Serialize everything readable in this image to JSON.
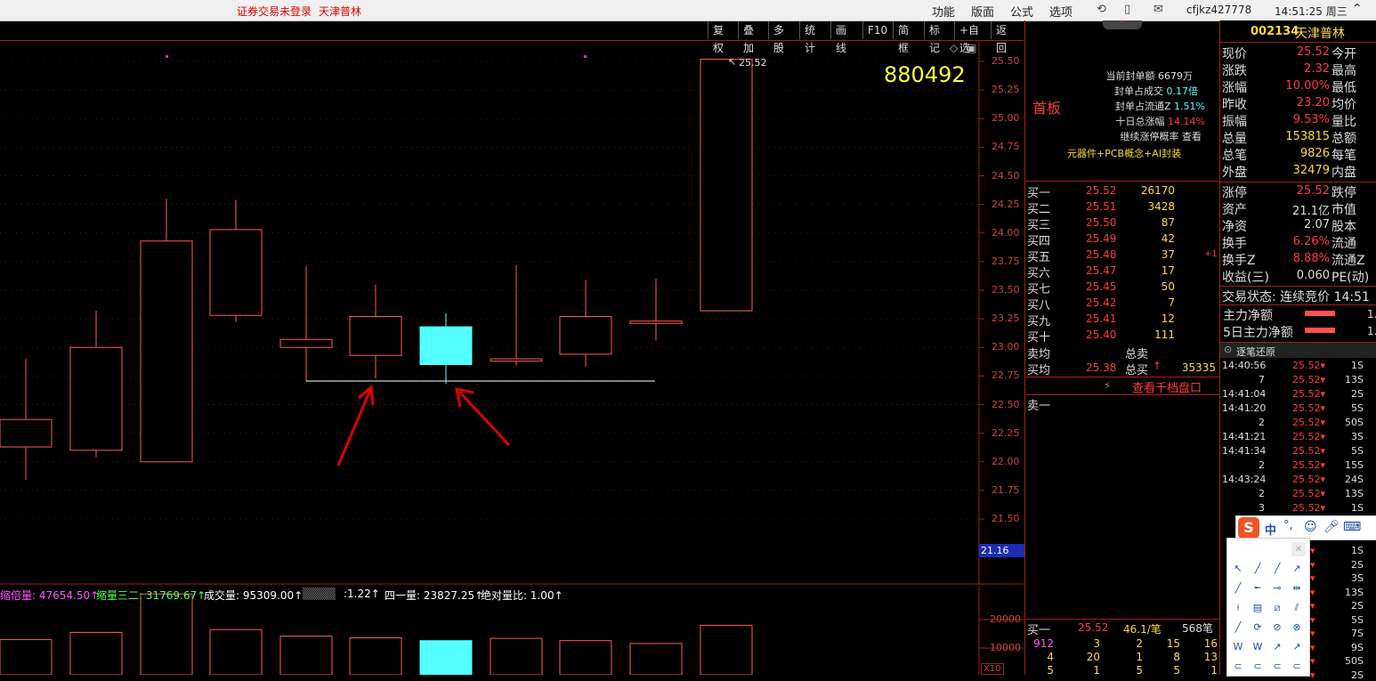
{
  "topbar": {
    "login_status": "证券交易未登录",
    "stock_name": "天津普林",
    "menus": [
      "功能",
      "版面",
      "公式",
      "选项"
    ],
    "user": "cfjkz427778",
    "clock": "14:51:25 周三"
  },
  "chart_toolbar": [
    "复权",
    "叠加",
    "多股",
    "统计",
    "画线",
    "F10",
    "简框",
    "标记",
    "+自选",
    "返回"
  ],
  "chart": {
    "code_overlay": "880492",
    "last_price_tag": "25.52",
    "cursor_price": "21.16",
    "y_ticks": [
      "25.50",
      "25.25",
      "25.00",
      "24.75",
      "24.50",
      "24.25",
      "24.00",
      "23.75",
      "23.50",
      "23.25",
      "23.00",
      "22.75",
      "22.50",
      "22.25",
      "22.00",
      "21.75",
      "21.50"
    ],
    "y_range": [
      21.25,
      25.6
    ],
    "candles": [
      {
        "open": 22.13,
        "close": 22.37,
        "high": 22.9,
        "low": 21.84
      },
      {
        "open": 22.1,
        "close": 23.0,
        "high": 23.32,
        "low": 22.04
      },
      {
        "open": 22.0,
        "close": 23.93,
        "high": 24.3,
        "low": 22.0
      },
      {
        "open": 23.28,
        "close": 24.03,
        "high": 24.29,
        "low": 23.22
      },
      {
        "open": 23.0,
        "close": 23.07,
        "high": 23.71,
        "low": 22.7
      },
      {
        "open": 22.93,
        "close": 23.27,
        "high": 23.55,
        "low": 22.73
      },
      {
        "open": 23.18,
        "close": 22.85,
        "high": 23.3,
        "low": 22.68
      },
      {
        "open": 22.88,
        "close": 22.9,
        "high": 23.72,
        "low": 22.84
      },
      {
        "open": 22.94,
        "close": 23.27,
        "high": 23.59,
        "low": 22.83
      },
      {
        "open": 23.21,
        "close": 23.23,
        "high": 23.6,
        "low": 23.06
      },
      {
        "open": 23.32,
        "close": 25.52,
        "high": 25.52,
        "low": 23.32
      }
    ],
    "colors": {
      "up": "#ff5a5a",
      "down": "#54ffff",
      "axis": "#a02020",
      "annot": "#e00000"
    }
  },
  "volume": {
    "indicators": [
      {
        "text": "缩倍量: 47654.50↑",
        "color": "#ff55ff"
      },
      {
        "text": "缩量三二: 31769.67↑",
        "color": "#55ff55"
      },
      {
        "text": "成交量: 95309.00↑",
        "color": "#ffffff"
      },
      {
        "text": ":1.22↑",
        "color": "#ffffff"
      },
      {
        "text": "四一量: 23827.25↑",
        "color": "#ffffff"
      },
      {
        "text": "绝对量比: 1.00↑",
        "color": "#ffffff"
      }
    ],
    "ticks": [
      "20000",
      "10000"
    ],
    "unit": "X10",
    "bars": [
      13000,
      15500,
      29000,
      16500,
      14200,
      13600,
      12600,
      13400,
      12600,
      11600,
      18000
    ]
  },
  "quote": {
    "code": "002134",
    "name": "天津普林",
    "board": "首板",
    "seal_info": [
      {
        "label": "当前封单额",
        "value": "6679万"
      },
      {
        "label": "封单占成交",
        "value": "0.17倍"
      },
      {
        "label": "封单占流通Z",
        "value": "1.51%"
      },
      {
        "label": "十日总涨幅",
        "value": "14.14%"
      },
      {
        "label": "继续涨停概率",
        "value": "查看"
      }
    ],
    "concepts": "元器件+PCB概念+AI封装",
    "stats": [
      {
        "label": "现价",
        "value": "25.52",
        "tail": "今开"
      },
      {
        "label": "涨跌",
        "value": "2.32",
        "tail": "最高"
      },
      {
        "label": "涨幅",
        "value": "10.00%",
        "tail": "最低"
      },
      {
        "label": "昨收",
        "value": "23.20",
        "tail": "均价"
      },
      {
        "label": "振幅",
        "value": "9.53%",
        "tail": "量比"
      },
      {
        "label": "总量",
        "value": "153815",
        "tail": "总额"
      },
      {
        "label": "总笔",
        "value": "9826",
        "tail": "每笔"
      },
      {
        "label": "外盘",
        "value": "32479",
        "tail": "内盘"
      }
    ],
    "stats2": [
      {
        "label": "涨停",
        "value": "25.52",
        "tail": "跌停"
      },
      {
        "label": "资产",
        "value": "21.1亿",
        "tail": "市值"
      },
      {
        "label": "净资",
        "value": "2.07",
        "tail": "股本"
      },
      {
        "label": "换手",
        "value": "6.26%",
        "tail": "流通"
      },
      {
        "label": "换手Z",
        "value": "8.88%",
        "tail": "流通Z"
      },
      {
        "label": "收益(三)",
        "value": "0.060",
        "tail": "PE(动)"
      }
    ],
    "trade_status": "交易状态: 连续竞价 14:51",
    "main_net": "主力净额",
    "main_net5": "5日主力净额",
    "main_net_val": "1.",
    "main_net5_val": "1."
  },
  "orderbook": {
    "bids": [
      {
        "label": "买一",
        "price": "25.52",
        "vol": "26170"
      },
      {
        "label": "买二",
        "price": "25.51",
        "vol": "3428"
      },
      {
        "label": "买三",
        "price": "25.50",
        "vol": "87"
      },
      {
        "label": "买四",
        "price": "25.49",
        "vol": "42"
      },
      {
        "label": "买五",
        "price": "25.48",
        "vol": "37",
        "extra": "+1"
      },
      {
        "label": "买六",
        "price": "25.47",
        "vol": "17"
      },
      {
        "label": "买七",
        "price": "25.45",
        "vol": "50"
      },
      {
        "label": "买八",
        "price": "25.42",
        "vol": "7"
      },
      {
        "label": "买九",
        "price": "25.41",
        "vol": "12"
      },
      {
        "label": "买十",
        "price": "25.40",
        "vol": "111"
      }
    ],
    "sell_avg": "卖均",
    "total_sell": "总卖",
    "buy_avg": "买均",
    "buy_avg_price": "25.38",
    "total_buy": "总买",
    "total_buy_vol": "35335",
    "view_depth": "查看千档盘口",
    "ask1": "卖一",
    "bottom_row": {
      "label": "买一",
      "price": "25.52",
      "per": "46.1/笔",
      "count": "568笔"
    },
    "queue": [
      [
        "912",
        "3",
        "2",
        "15",
        "16"
      ],
      [
        "4",
        "20",
        "1",
        "8",
        "13"
      ],
      [
        "5",
        "1",
        "5",
        "5",
        "1"
      ]
    ]
  },
  "ticks": {
    "title": "逐笔还原",
    "rows": [
      {
        "time": "14:40:56",
        "price": "25.52",
        "vol": "1S"
      },
      {
        "time": "7",
        "price": "25.52",
        "vol": "13S"
      },
      {
        "time": "14:41:04",
        "price": "25.52",
        "vol": "2S"
      },
      {
        "time": "14:41:20",
        "price": "25.52",
        "vol": "5S"
      },
      {
        "time": "2",
        "price": "25.52",
        "vol": "50S"
      },
      {
        "time": "14:41:21",
        "price": "25.52",
        "vol": "3S"
      },
      {
        "time": "14:41:34",
        "price": "25.52",
        "vol": "5S"
      },
      {
        "time": "2",
        "price": "25.52",
        "vol": "15S"
      },
      {
        "time": "14:43:24",
        "price": "25.52",
        "vol": "24S"
      },
      {
        "time": "2",
        "price": "25.52",
        "vol": "13S"
      },
      {
        "time": "3",
        "price": "25.52",
        "vol": "1S"
      }
    ],
    "more_vols": [
      "1S",
      "2S",
      "3S",
      "13S",
      "2S",
      "5S",
      "7S",
      "9S",
      "50S",
      "2S"
    ]
  },
  "ime": {
    "lang": "中",
    "punct": "°,"
  }
}
